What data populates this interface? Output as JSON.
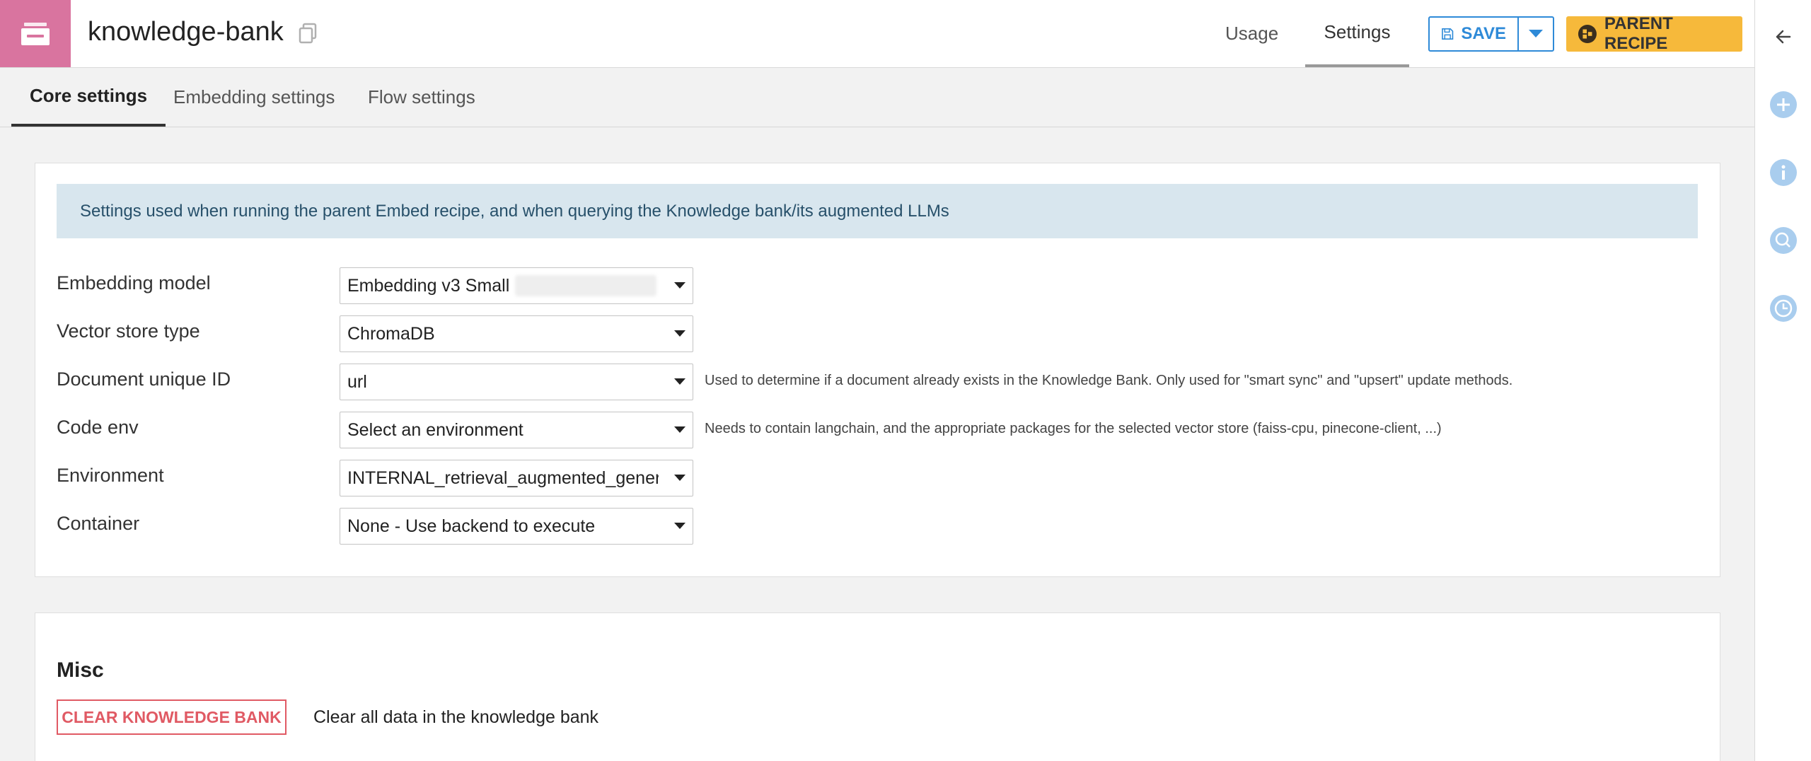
{
  "header": {
    "title": "knowledge-bank",
    "tabs": [
      "Usage",
      "Settings"
    ],
    "active_tab": "Settings",
    "save_label": "SAVE",
    "parent_recipe_label": "PARENT RECIPE"
  },
  "subtabs": [
    "Core settings",
    "Embedding settings",
    "Flow settings"
  ],
  "active_subtab": "Core settings",
  "core": {
    "info": "Settings used when running the parent Embed recipe, and when querying the Knowledge bank/its augmented LLMs",
    "rows": [
      {
        "label": "Embedding model",
        "value": "Embedding v3 Small",
        "hint": ""
      },
      {
        "label": "Vector store type",
        "value": "ChromaDB",
        "hint": ""
      },
      {
        "label": "Document unique ID",
        "value": "url",
        "hint": "Used to determine if a document already exists in the Knowledge Bank. Only used for \"smart sync\" and \"upsert\" update methods."
      },
      {
        "label": "Code env",
        "value": "Select an environment",
        "hint": "Needs to contain langchain, and the appropriate packages for the selected vector store (faiss-cpu, pinecone-client, ...)"
      },
      {
        "label": "Environment",
        "value": "INTERNAL_retrieval_augmented_generat",
        "hint": ""
      },
      {
        "label": "Container",
        "value": "None - Use backend to execute",
        "hint": ""
      }
    ]
  },
  "misc": {
    "title": "Misc",
    "clear_button": "CLEAR KNOWLEDGE BANK",
    "clear_description": "Clear all data in the knowledge bank"
  },
  "colors": {
    "object_icon_bg": "#d9749f",
    "save_accent": "#2e8ad8",
    "parent_recipe_bg": "#f6b93b",
    "danger": "#e05a64",
    "info_bg": "#d8e6ee",
    "sidebar_icon": "#a9cdee"
  },
  "icons": {
    "object": "knowledge-bank-icon",
    "copy": "copy-icon",
    "save": "floppy-disk-icon",
    "parent_recipe": "recipe-icon",
    "sidebar": [
      "arrow-left-icon",
      "plus-circle-icon",
      "info-circle-icon",
      "chat-icon",
      "clock-icon"
    ]
  }
}
